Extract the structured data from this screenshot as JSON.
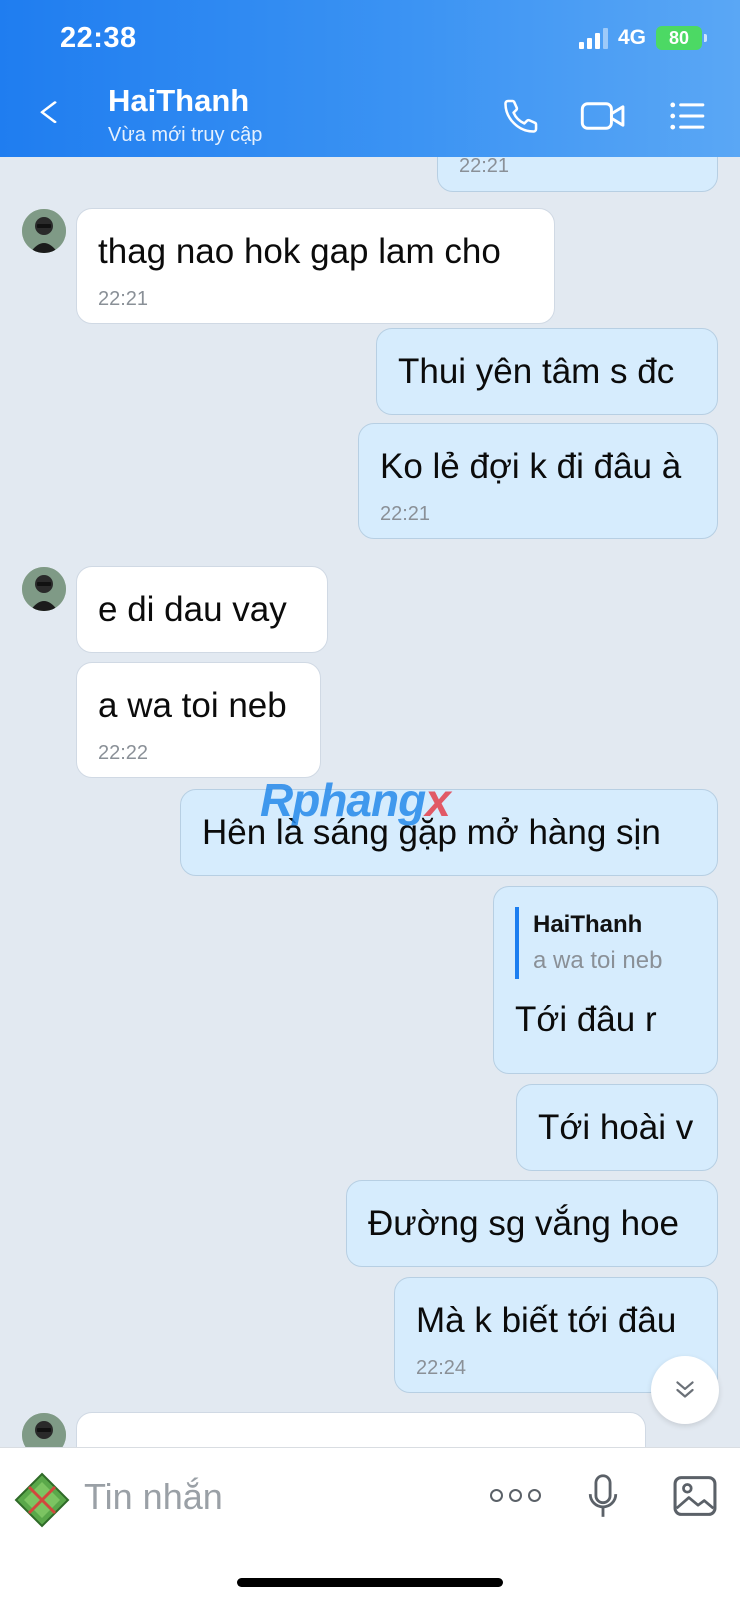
{
  "status_bar": {
    "time": "22:38",
    "network": "4G",
    "battery": "80"
  },
  "header": {
    "contact_name": "HaiThanh",
    "status": "Vừa mới truy cập"
  },
  "messages": [
    {
      "text": "",
      "time": "22:21"
    },
    {
      "text": "thag nao hok gap lam cho",
      "time": "22:21"
    },
    {
      "text": "Thui yên tâm s đc"
    },
    {
      "text": "Ko lẻ đợi k đi đâu à",
      "time": "22:21"
    },
    {
      "text": "e di dau vay"
    },
    {
      "text": "a wa toi neb",
      "time": "22:22"
    },
    {
      "text": "Hên là sáng gặp mở hàng sịn"
    },
    {
      "text": "Tới đâu r",
      "quote_name": "HaiThanh",
      "quote_text": "a wa toi neb"
    },
    {
      "text": "Tới hoài v"
    },
    {
      "text": "Đường sg vắng hoe"
    },
    {
      "text": "Mà k biết tới đâu",
      "time": "22:24"
    }
  ],
  "watermark": {
    "part1": "Rphang",
    "part2": "x"
  },
  "input": {
    "placeholder": "Tin nhắn"
  },
  "colors": {
    "header_start": "#1f7df0",
    "header_end": "#5aa7f5",
    "outgoing_bubble": "#d6ecfd",
    "incoming_bubble": "#ffffff",
    "chat_background": "#e2e9f1"
  }
}
